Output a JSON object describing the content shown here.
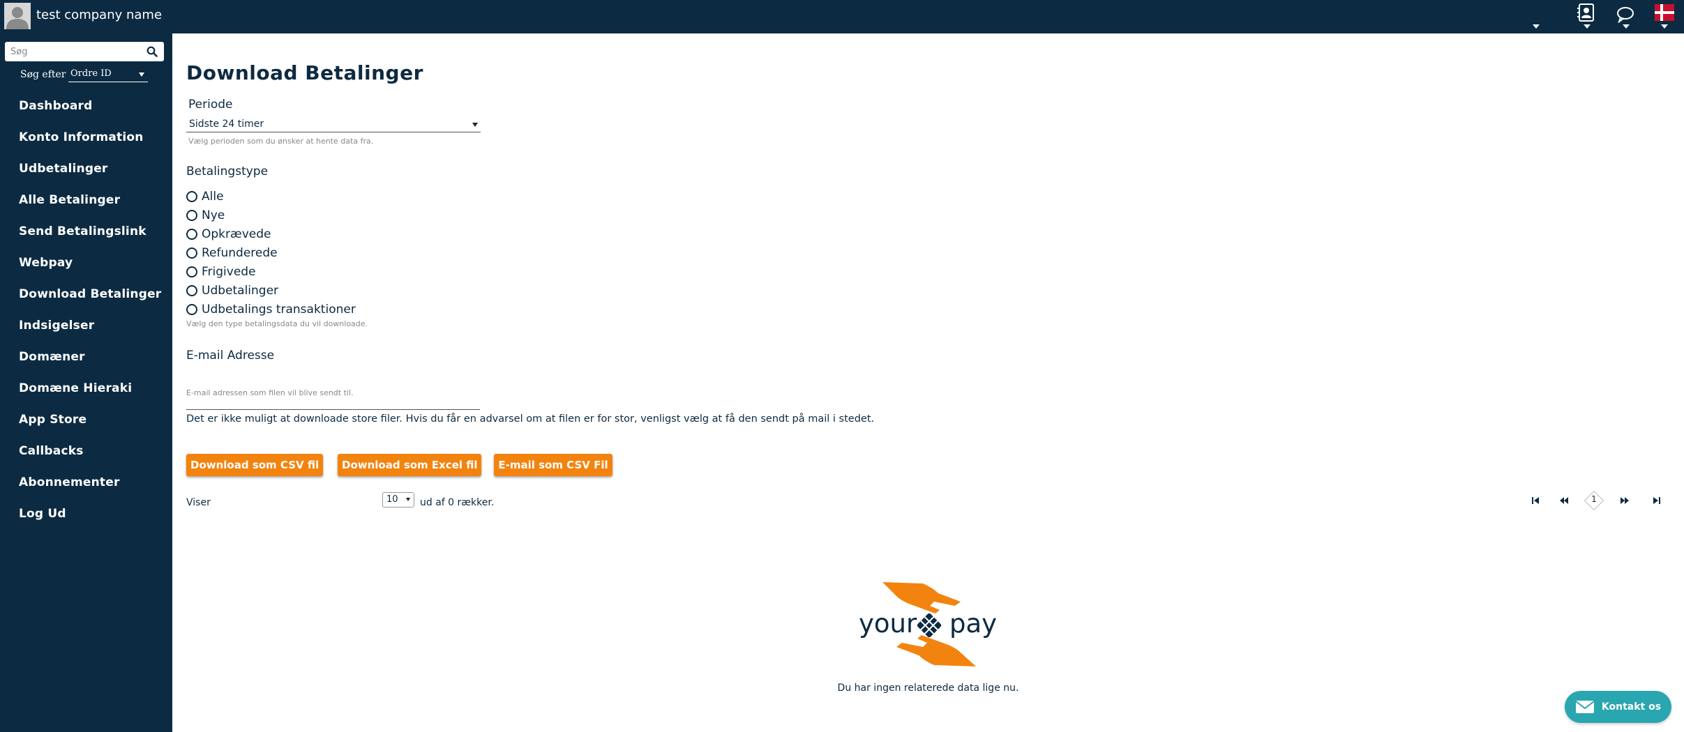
{
  "header": {
    "company_name": "test company name"
  },
  "sidebar": {
    "search_placeholder": "Søg",
    "search_by_label": "Søg efter",
    "search_by_value": "Ordre ID",
    "items": [
      {
        "label": "Dashboard"
      },
      {
        "label": "Konto Information"
      },
      {
        "label": "Udbetalinger"
      },
      {
        "label": "Alle Betalinger"
      },
      {
        "label": "Send Betalingslink"
      },
      {
        "label": "Webpay"
      },
      {
        "label": "Download Betalinger"
      },
      {
        "label": "Indsigelser"
      },
      {
        "label": "Domæner"
      },
      {
        "label": "Domæne Hieraki"
      },
      {
        "label": "App Store"
      },
      {
        "label": "Callbacks"
      },
      {
        "label": "Abonnementer"
      },
      {
        "label": "Log Ud"
      }
    ]
  },
  "main": {
    "title": "Download Betalinger",
    "period": {
      "label": "Periode",
      "value": "Sidste 24 timer",
      "hint": "Vælg perioden som du ønsker at hente data fra."
    },
    "payment_type": {
      "label": "Betalingstype",
      "options": [
        "Alle",
        "Nye",
        "Opkrævede",
        "Refunderede",
        "Frigivede",
        "Udbetalinger",
        "Udbetalings transaktioner"
      ],
      "hint": "Vælg den type betalingsdata du vil downloade."
    },
    "email": {
      "label": "E-mail Adresse",
      "value": "",
      "hint": "E-mail adressen som filen vil blive sendt til."
    },
    "note": "Det er ikke muligt at downloade store filer. Hvis du får en advarsel om at filen er for stor, venligst vælg at få den sendt på mail i stedet.",
    "buttons": {
      "csv": "Download som CSV fil",
      "excel": "Download som Excel fil",
      "email_csv": "E-mail som CSV Fil"
    },
    "table": {
      "showing_prefix": "Viser",
      "rows_per_page": "10",
      "showing_suffix": "ud af 0 rækker.",
      "current_page": "1"
    },
    "logo": {
      "left_text": "your",
      "right_text": "pay"
    },
    "empty_text": "Du har ingen relaterede data lige nu."
  },
  "contact": {
    "label": "Kontakt os"
  },
  "colors": {
    "navy": "#0c2b42",
    "orange": "#f3830f",
    "teal": "#2aa6b0"
  }
}
